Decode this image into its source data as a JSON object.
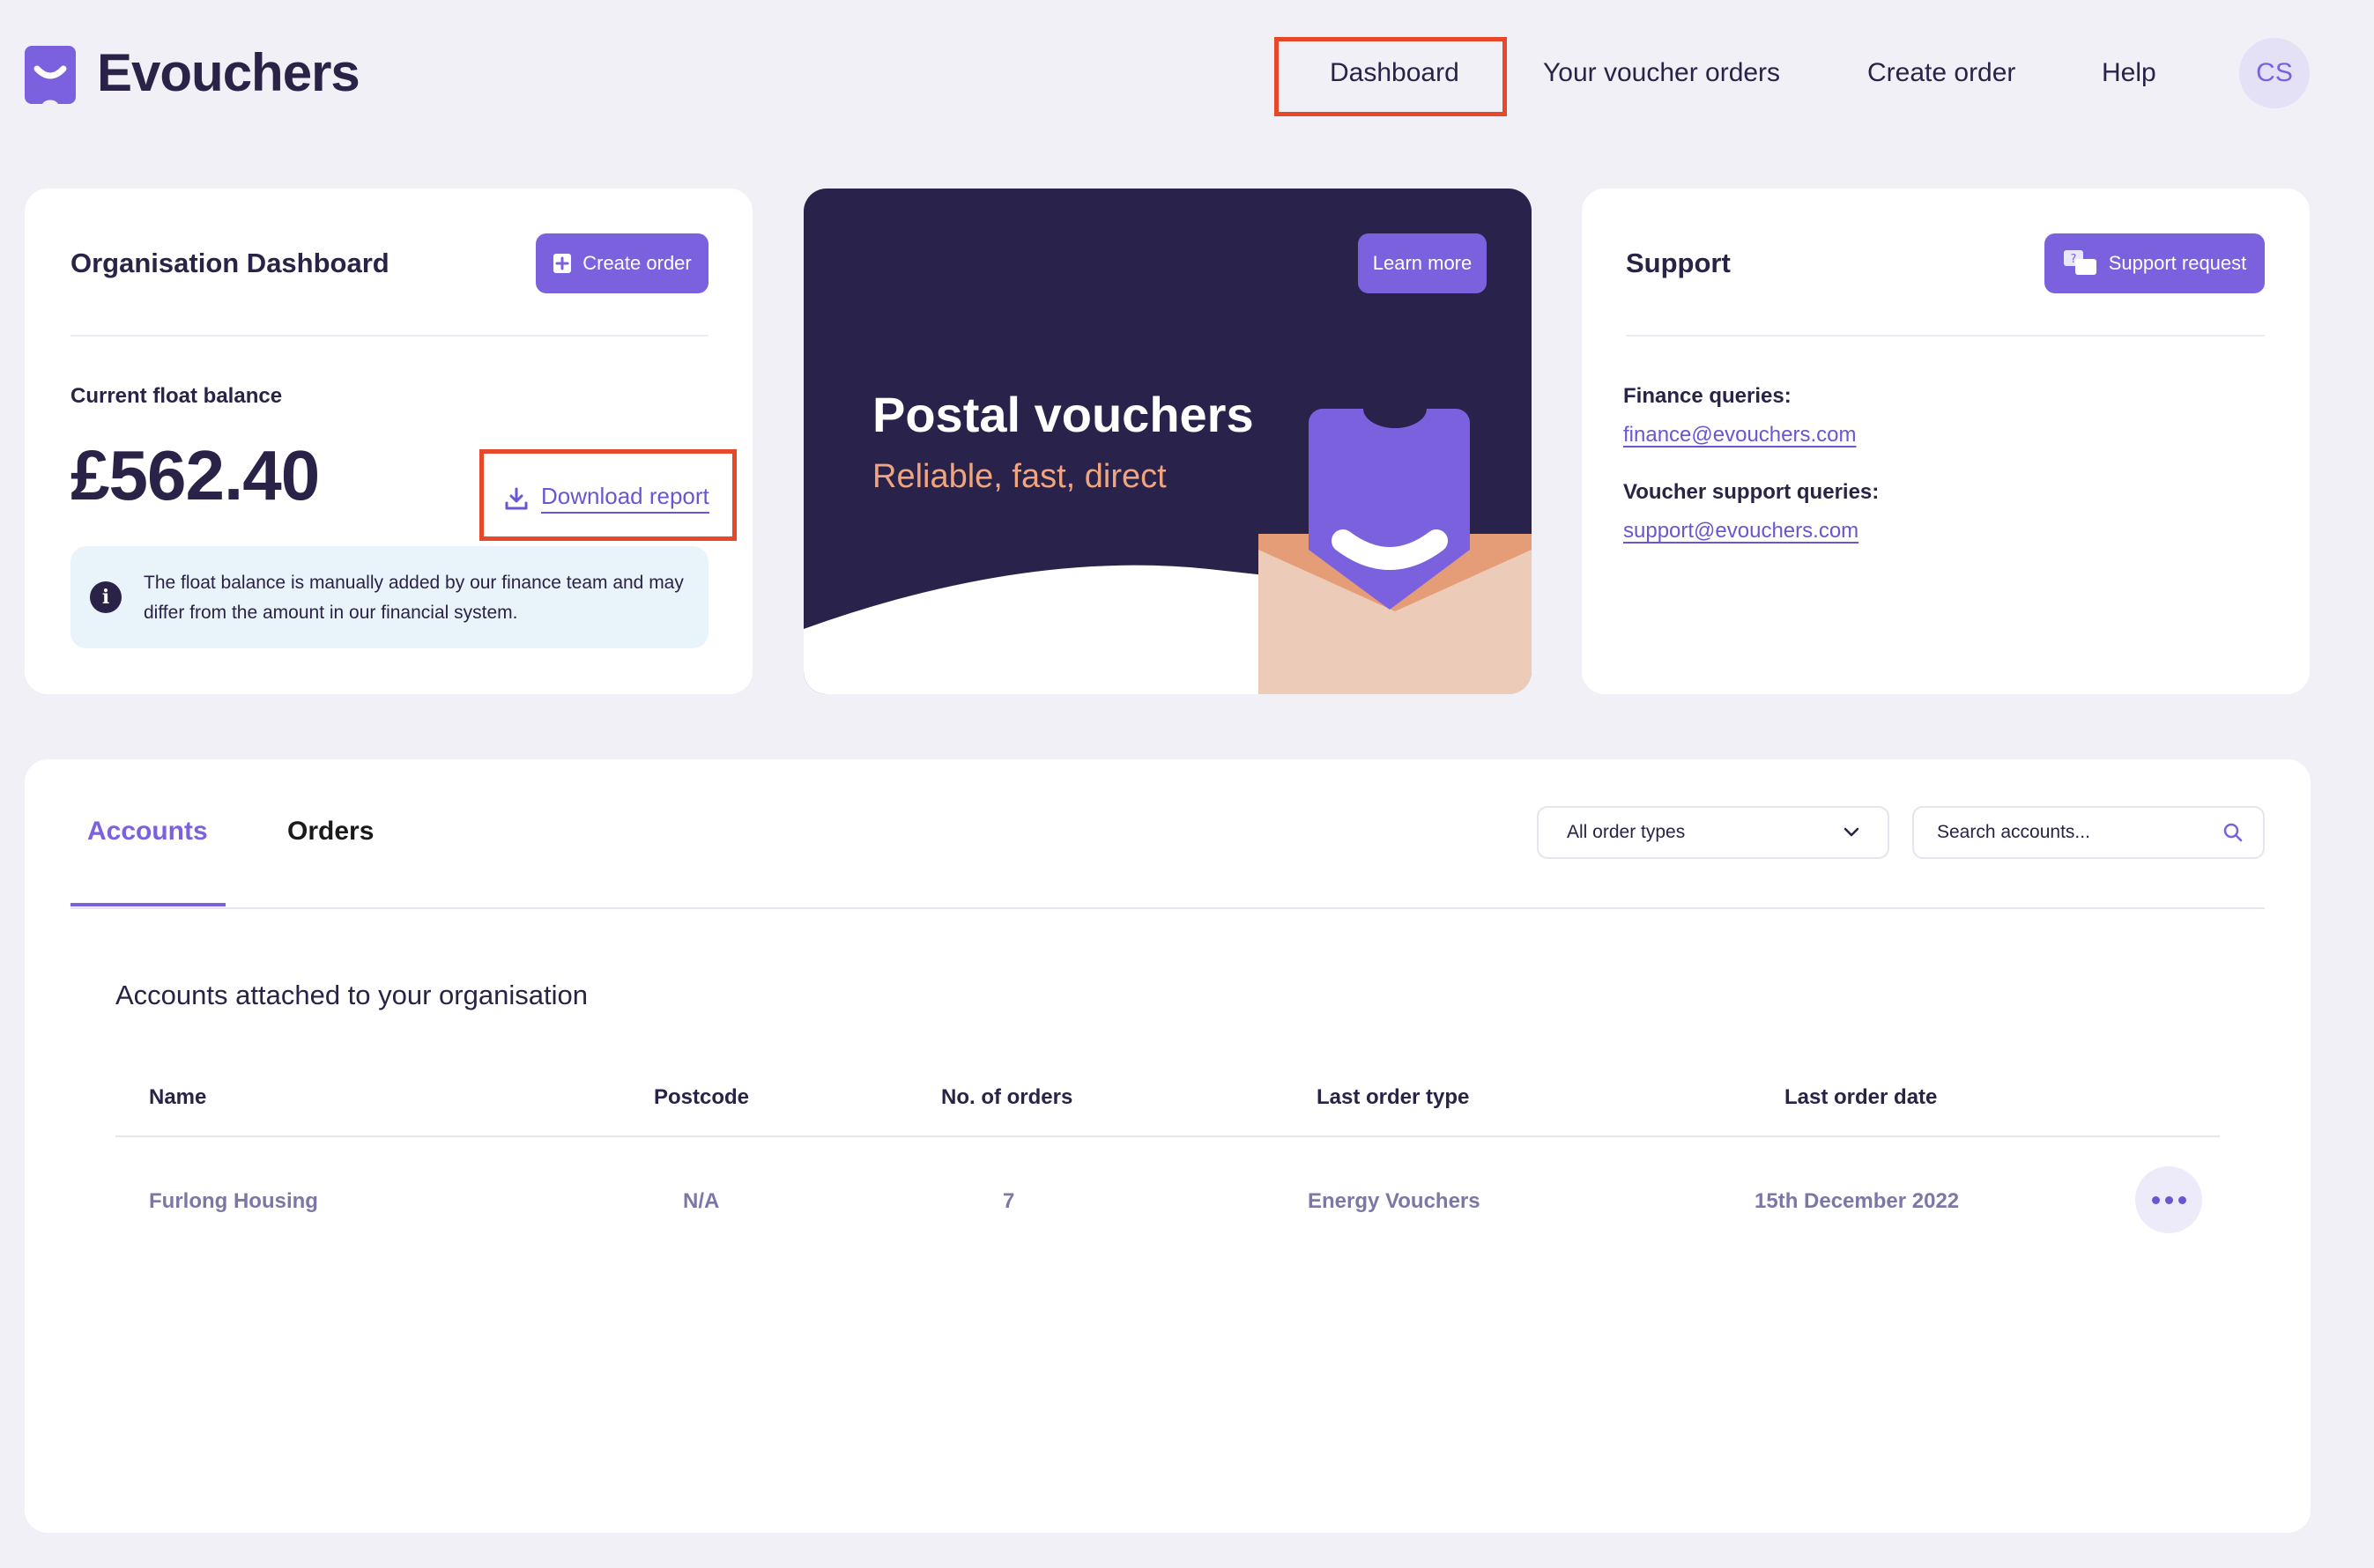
{
  "brand": {
    "name": "Evouchers"
  },
  "nav": {
    "items": [
      {
        "label": "Dashboard"
      },
      {
        "label": "Your voucher orders"
      },
      {
        "label": "Create order"
      },
      {
        "label": "Help"
      }
    ],
    "avatar_initials": "CS"
  },
  "org_card": {
    "title": "Organisation Dashboard",
    "create_order_label": "Create order",
    "balance_label": "Current float balance",
    "balance_value": "£562.40",
    "download_label": "Download report",
    "info_text": "The float balance is manually added by our finance team and may differ from the amount in our financial system."
  },
  "promo": {
    "learn_more_label": "Learn more",
    "title": "Postal vouchers",
    "subtitle": "Reliable, fast, direct"
  },
  "support": {
    "title": "Support",
    "request_label": "Support request",
    "finance_label": "Finance queries:",
    "finance_email": "finance@evouchers.com",
    "voucher_label": "Voucher support queries:",
    "voucher_email": "support@evouchers.com"
  },
  "panel": {
    "tabs": [
      {
        "label": "Accounts"
      },
      {
        "label": "Orders"
      }
    ],
    "filter_value": "All order types",
    "search_placeholder": "Search accounts...",
    "section_title": "Accounts attached to your organisation",
    "columns": [
      "Name",
      "Postcode",
      "No. of orders",
      "Last order type",
      "Last order date"
    ],
    "rows": [
      {
        "name": "Furlong Housing",
        "postcode": "N/A",
        "orders": "7",
        "last_type": "Energy Vouchers",
        "last_date": "15th December 2022"
      }
    ]
  },
  "colors": {
    "accent": "#7B61DE",
    "dark": "#2A2247",
    "highlight": "#E8482A",
    "promo_subtitle": "#F0A57E",
    "background": "#F1F0F6"
  }
}
